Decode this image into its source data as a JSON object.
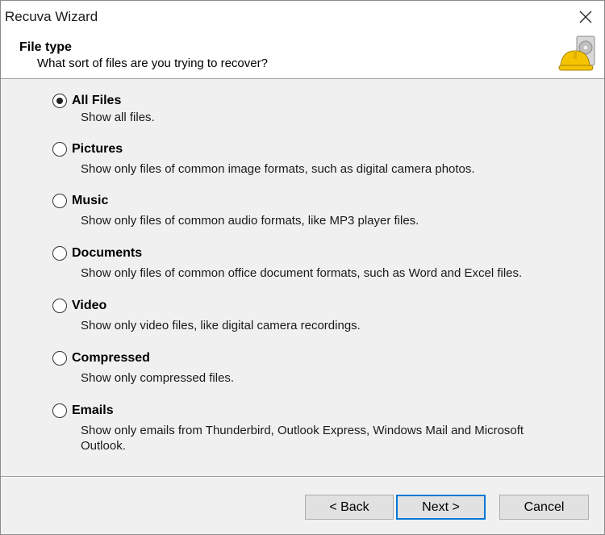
{
  "window": {
    "title": "Recuva Wizard"
  },
  "header": {
    "title": "File type",
    "subtitle": "What sort of files are you trying to recover?"
  },
  "options": [
    {
      "label": "All Files",
      "description": "Show all files.",
      "selected": true
    },
    {
      "label": "Pictures",
      "description": "Show only files of common image formats, such as digital camera photos.",
      "selected": false
    },
    {
      "label": "Music",
      "description": "Show only files of common audio formats, like MP3 player files.",
      "selected": false
    },
    {
      "label": "Documents",
      "description": "Show only files of common office document formats, such as Word and Excel files.",
      "selected": false
    },
    {
      "label": "Video",
      "description": "Show only video files, like digital camera recordings.",
      "selected": false
    },
    {
      "label": "Compressed",
      "description": "Show only compressed files.",
      "selected": false
    },
    {
      "label": "Emails",
      "description": "Show only emails from Thunderbird, Outlook Express, Windows Mail and Microsoft Outlook.",
      "selected": false
    }
  ],
  "buttons": {
    "back": "< Back",
    "next": "Next >",
    "cancel": "Cancel"
  },
  "colors": {
    "accent": "#0078d7",
    "button_face": "#e1e1e1",
    "dialog_bg": "#f0f0f0",
    "logo_yellow": "#f5c400"
  },
  "icons": {
    "close": "close-icon",
    "logo": "recuva-hardhat-drive-icon"
  }
}
